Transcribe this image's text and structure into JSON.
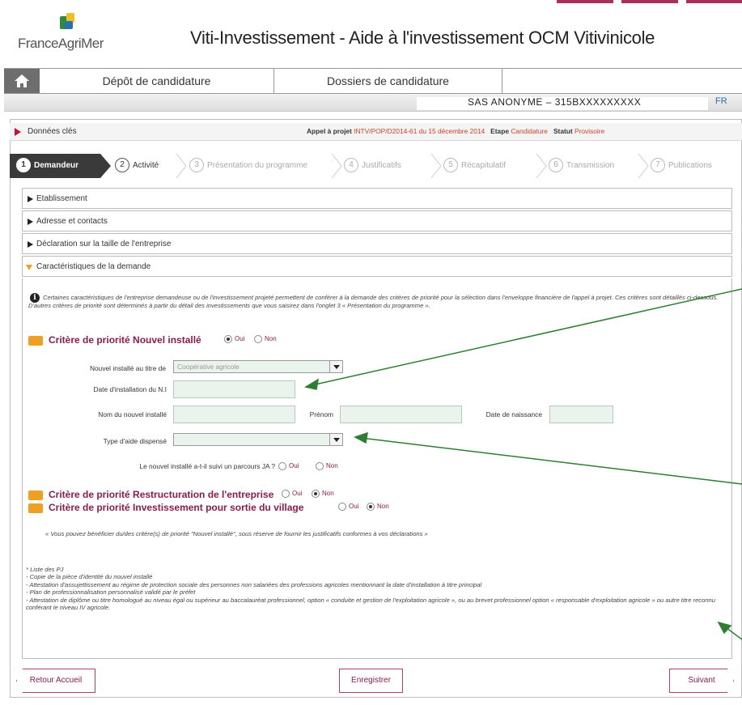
{
  "branding": {
    "logo_text": "FranceAgriMer"
  },
  "app": {
    "title": "Viti-Investissement - Aide à l'investissement OCM Vitivinicole"
  },
  "nav": {
    "home_icon": "home-icon",
    "tabs": [
      {
        "label": "Dépôt de candidature"
      },
      {
        "label": "Dossiers de candidature"
      }
    ]
  },
  "user": {
    "name": "SAS ANONYME – 315BXXXXXXXXX",
    "lang": "FR"
  },
  "keybar": {
    "label": "Données clés",
    "appel_label": "Appel à projet",
    "appel_value": "INTV/POP/D2014-61 du 15 décembre 2014",
    "etape_label": "Etape",
    "etape_value": "Candidature",
    "statut_label": "Statut",
    "statut_value": "Provisoire"
  },
  "steps": [
    {
      "num": "1",
      "label": "Demandeur"
    },
    {
      "num": "2",
      "label": "Activité"
    },
    {
      "num": "3",
      "label": "Présentation du programme"
    },
    {
      "num": "4",
      "label": "Justificatifs"
    },
    {
      "num": "5",
      "label": "Récapitulatif"
    },
    {
      "num": "6",
      "label": "Transmission"
    },
    {
      "num": "7",
      "label": "Publications"
    }
  ],
  "sections": [
    {
      "label": "Etablissement"
    },
    {
      "label": "Adresse et contacts"
    },
    {
      "label": "Déclaration sur la taille de l'entreprise"
    },
    {
      "label": "Caractéristiques de la demande"
    }
  ],
  "intro_text": "Certaines caractéristiques de l'entreprise demandeuse ou de l'investissement projeté permettent de conférer à la demande des critères de priorité pour la sélection dans l'enveloppe financière de l'appel à projet. Ces critères sont détaillés ci-dessous. D'autres critères de priorité sont déterminés à partir du détail des investissements que vous saisirez dans l'onglet 3 « Présentation du programme ».",
  "criteria": [
    {
      "title": "Critère de priorité Nouvel installé",
      "yes": "Oui",
      "no": "Non",
      "selected": "oui"
    },
    {
      "title": "Critère de priorité Restructuration de l'entreprise",
      "yes": "Oui",
      "no": "Non",
      "selected": "non"
    },
    {
      "title": "Critère de priorité Investissement pour sortie du village",
      "yes": "Oui",
      "no": "Non",
      "selected": "non"
    }
  ],
  "form": {
    "nouvel_installe_label": "Nouvel installé au titre de",
    "nouvel_installe_value": "Coopérative agricole",
    "date_installation_label": "Date d'installation du N.I",
    "nom_label": "Nom du nouvel installé",
    "prenom_label": "Prénom",
    "date_naissance_label": "Date de naissance",
    "type_aide_label": "Type d'aide dispensé",
    "parcours_label": "Le nouvel installé a-t-il suivi un parcours JA ?",
    "parcours_yes": "Oui",
    "parcours_no": "Non"
  },
  "notice": "« Vous pouvez bénéficier du/des critère(s) de priorité \"Nouvel installé\", sous réserve de fournir les justificatifs conformes à vos déclarations »",
  "pj": {
    "title": "* Liste des PJ",
    "items": [
      "- Copie de la pièce d'identité du nouvel installé",
      "- Attestation d'assujettissement au régime de protection sociale des personnes non salariées des professions agricoles mentionnant la date d'installation à titre principal",
      "- Plan de professionnalisation personnalisé validé par le préfet",
      "- Attestation de diplôme ou titre homologué au niveau égal ou supérieur au baccalauréat professionnel, option « conduite et gestion de l'exploitation agricole », ou au brevet professionnel option « responsable d'exploitation agricole » ou autre titre reconnu conférant le niveau IV agricole."
    ]
  },
  "buttons": {
    "back": "Retour Accueil",
    "save": "Enregistrer",
    "next": "Suivant"
  },
  "colors": {
    "accent": "#8b1c4b",
    "badge": "#f0a020",
    "arrow": "#2e7d32",
    "active_step": "#3a3a3a"
  }
}
